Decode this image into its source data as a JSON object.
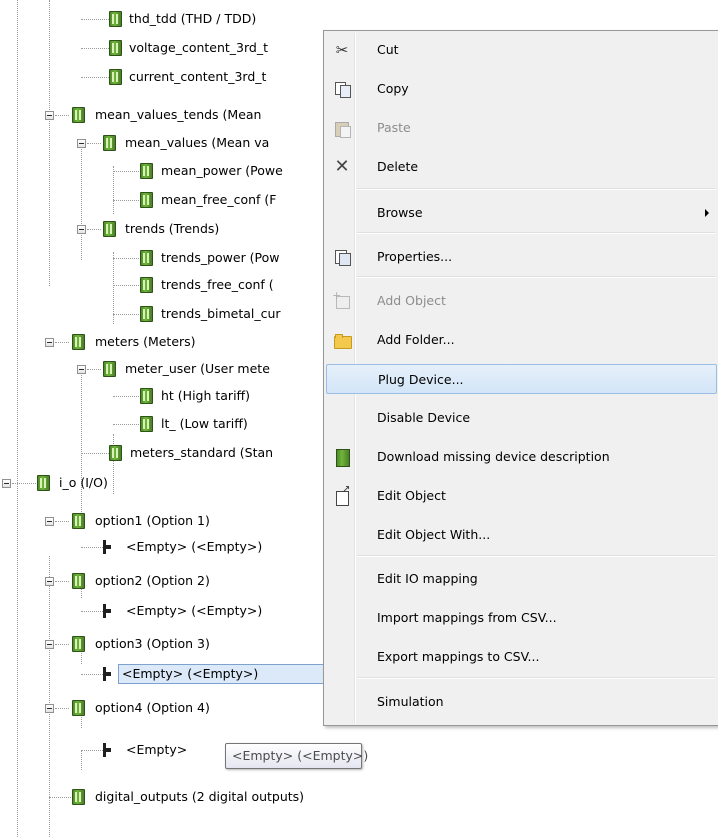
{
  "tree": {
    "rows": [
      {
        "label": "thd_tdd (THD / TDD)"
      },
      {
        "label": "voltage_content_3rd_t"
      },
      {
        "label": "current_content_3rd_t"
      },
      {
        "label": "mean_values_tends (Mean"
      },
      {
        "label": "mean_values (Mean va"
      },
      {
        "label": "mean_power (Powe"
      },
      {
        "label": "mean_free_conf (F"
      },
      {
        "label": "trends (Trends)"
      },
      {
        "label": "trends_power (Pow"
      },
      {
        "label": "trends_free_conf ("
      },
      {
        "label": "trends_bimetal_cur"
      },
      {
        "label": "meters (Meters)"
      },
      {
        "label": "meter_user (User mete"
      },
      {
        "label": "ht (High tariff)"
      },
      {
        "label": "lt_ (Low tariff)"
      },
      {
        "label": "meters_standard (Stan"
      },
      {
        "label": "i_o (I/O)"
      },
      {
        "label": "option1 (Option 1)"
      },
      {
        "label": "<Empty> (<Empty>)"
      },
      {
        "label": "option2 (Option 2)"
      },
      {
        "label": "<Empty> (<Empty>)"
      },
      {
        "label": "option3 (Option 3)"
      },
      {
        "label": "<Empty> (<Empty>)"
      },
      {
        "label": "option4 (Option 4)"
      },
      {
        "label": "<Empty>"
      },
      {
        "label": "digital_outputs (2 digital outputs)"
      }
    ]
  },
  "context_menu": {
    "items": [
      {
        "label": "Cut",
        "icon": "scissors-icon"
      },
      {
        "label": "Copy",
        "icon": "copy-icon"
      },
      {
        "label": "Paste",
        "icon": "paste-icon",
        "disabled": true
      },
      {
        "label": "Delete",
        "icon": "delete-icon"
      },
      {
        "label": "Browse",
        "submenu": true
      },
      {
        "label": "Properties...",
        "icon": "properties-icon"
      },
      {
        "label": "Add Object",
        "icon": "add-object-icon",
        "disabled": true
      },
      {
        "label": "Add Folder...",
        "icon": "folder-icon"
      },
      {
        "label": "Plug Device...",
        "highlighted": true
      },
      {
        "label": "Disable Device"
      },
      {
        "label": "Download missing device description",
        "icon": "device-icon"
      },
      {
        "label": "Edit Object",
        "icon": "edit-object-icon"
      },
      {
        "label": "Edit Object With..."
      },
      {
        "label": "Edit IO mapping"
      },
      {
        "label": "Import mappings from CSV..."
      },
      {
        "label": "Export mappings to CSV..."
      },
      {
        "label": "Simulation"
      }
    ]
  },
  "tooltip": {
    "text": "<Empty> (<Empty>)"
  },
  "colors": {
    "selection": "#dbe9f8",
    "selection_border": "#7da2ce",
    "menu_bg": "#f0f0f0",
    "menu_highlight": "#d3e5f8",
    "disabled_text": "#8d8d8d",
    "device_green": "#6fb53a"
  }
}
